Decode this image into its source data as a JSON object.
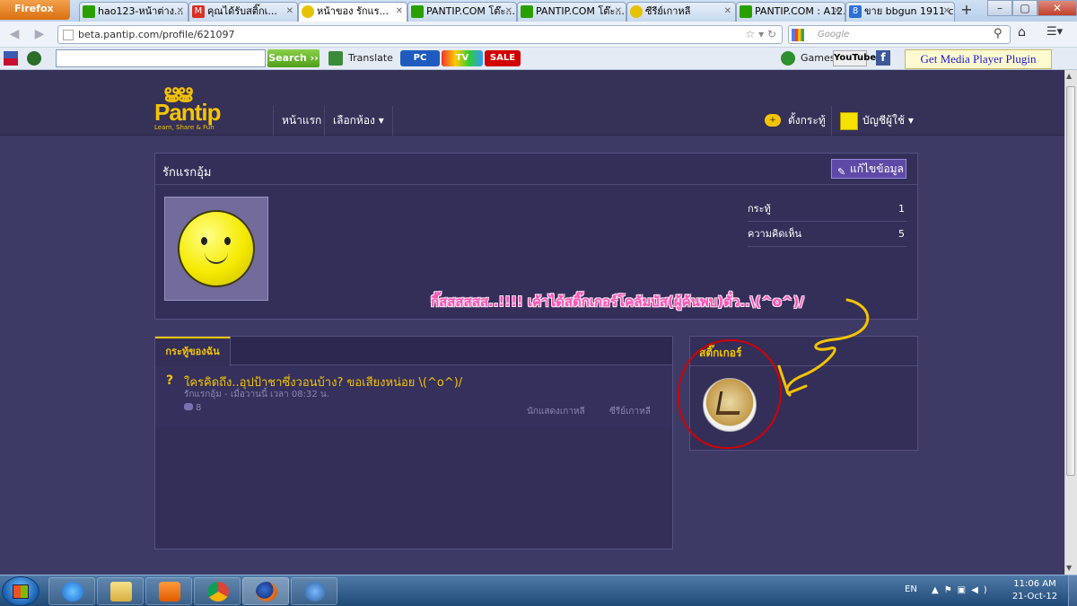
{
  "browser": {
    "menu_button": "Firefox",
    "tabs": [
      {
        "label": "hao123-หน้าต่าง...",
        "icon": "hao123-icon",
        "color": "#2aa000"
      },
      {
        "label": "คุณได้รับสติ๊กเ...",
        "icon": "gmail-icon",
        "color": "#d93025"
      },
      {
        "label": "หน้าของ รักแร...",
        "icon": "smiley-icon",
        "color": "#e6c200"
      },
      {
        "label": "PANTIP.COM โต๊ะ...",
        "icon": "cactus-icon",
        "color": "#2aa000"
      },
      {
        "label": "PANTIP.COM โต๊ะ...",
        "icon": "cactus-icon",
        "color": "#2aa000"
      },
      {
        "label": "ซีรีย์เกาหลี",
        "icon": "smiley-icon",
        "color": "#e6c200"
      },
      {
        "label": "PANTIP.COM : A12...",
        "icon": "cactus-icon",
        "color": "#2aa000"
      },
      {
        "label": "ขาย bbgun 1911 co...",
        "icon": "eight-icon",
        "color": "#2d6fd6"
      }
    ],
    "new_tab": "+",
    "url": "beta.pantip.com/profile/621097",
    "search_engine_placeholder": "Google"
  },
  "toolbar": {
    "search_button": "Search",
    "translate": "Translate",
    "pc_badge": "PC",
    "tv_badge": "TV",
    "sale_badge": "SALE",
    "games": "Games",
    "youtube": "YouTube",
    "facebook": "f",
    "plugin_notice": "Get Media Player Plugin"
  },
  "site": {
    "logo_text": "Pantip",
    "logo_tagline": "Learn, Share & Fun",
    "nav_home": "หน้าแรก",
    "nav_rooms": "เลือกห้อง ▾",
    "new_topic": "ตั้งกระทู้",
    "account": "บัญชีผู้ใช้ ▾"
  },
  "profile": {
    "name": "รักแรกอุ้ม",
    "edit_button": "แก้ไขข้อมูล",
    "stats": [
      {
        "label": "กระทู้",
        "value": "1"
      },
      {
        "label": "ความคิดเห็น",
        "value": "5"
      }
    ]
  },
  "annotation": "กี๊สสสสสส..!!!!  เค้าได้สติ๊กเกอร์โคลัมบัส(ผู้ค้นพบ)ตั๋ว..\\(^o^)/",
  "topics": {
    "tab": "กระทู้ของฉัน",
    "items": [
      {
        "title": "ใครคิดถึง..อุปป้าชาซึ่งวอนบ้าง? ขอเสียงหน่อย \\(^o^)/",
        "meta": "รักแรกอุ้ม  -  เมื่อวานนี้  เวลา  08:32  น.",
        "comments": "8",
        "tags": [
          "นักแสดงเกาหลี",
          "ซีรีย์เกาหลี"
        ]
      }
    ]
  },
  "stickers": {
    "title": "สติ๊กเกอร์"
  },
  "taskbar": {
    "lang": "EN",
    "time": "11:06 AM",
    "date": "21-Oct-12"
  },
  "colors": {
    "accent": "#f5c400",
    "page_bg": "#3e3a66",
    "annotation": "#ff4fb4",
    "highlight_ring": "#d40000"
  }
}
